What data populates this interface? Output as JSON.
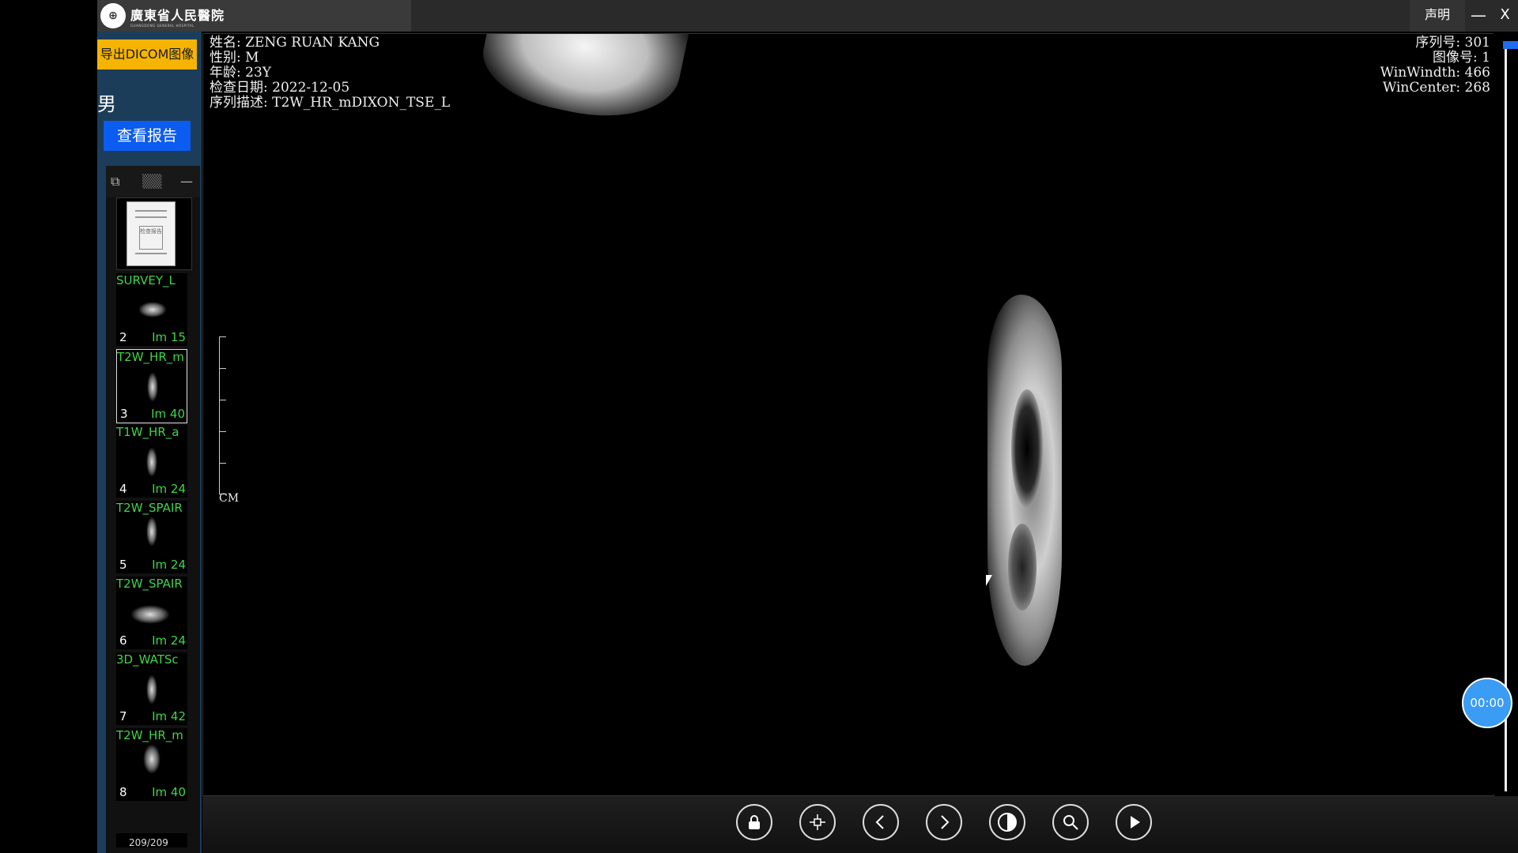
{
  "titlebar": {
    "hospital_name": "廣東省人民醫院",
    "hospital_sub": "GUANGDONG GENERAL HOSPITAL",
    "statement_label": "声明",
    "minimize_label": "—",
    "close_label": "X"
  },
  "sidebar": {
    "export_label": "导出DICOM图像",
    "gender": "男",
    "report_label": "查看报告",
    "report_thumb_text": "检查报告",
    "thumbnails": [
      {
        "name": "SURVEY_L",
        "num": "2",
        "im": "Im 15"
      },
      {
        "name": "T2W_HR_m",
        "num": "3",
        "im": "Im 40"
      },
      {
        "name": "T1W_HR_a",
        "num": "4",
        "im": "Im 24"
      },
      {
        "name": "T2W_SPAIR",
        "num": "5",
        "im": "Im 24"
      },
      {
        "name": "T2W_SPAIR",
        "num": "6",
        "im": "Im 24"
      },
      {
        "name": "3D_WATSc",
        "num": "7",
        "im": "Im 42"
      },
      {
        "name": "T2W_HR_m",
        "num": "8",
        "im": "Im 40"
      }
    ],
    "page_counter": "209/209"
  },
  "viewer": {
    "patient_name": "姓名: ZENG RUAN KANG",
    "sex": "性别: M",
    "age": "年龄: 23Y",
    "exam_date": "检查日期: 2022-12-05",
    "series_desc": "序列描述: T2W_HR_mDIXON_TSE_L",
    "series_no": "序列号: 301",
    "image_no": "图像号: 1",
    "win_width": "WinWindth: 466",
    "win_center": "WinCenter: 268",
    "scale_unit": "CM",
    "timer": "00:00"
  },
  "toolbar": {
    "tools": [
      "lock-icon",
      "crosshair-icon",
      "chevron-left-icon",
      "chevron-right-icon",
      "contrast-icon",
      "search-icon",
      "play-icon"
    ]
  }
}
